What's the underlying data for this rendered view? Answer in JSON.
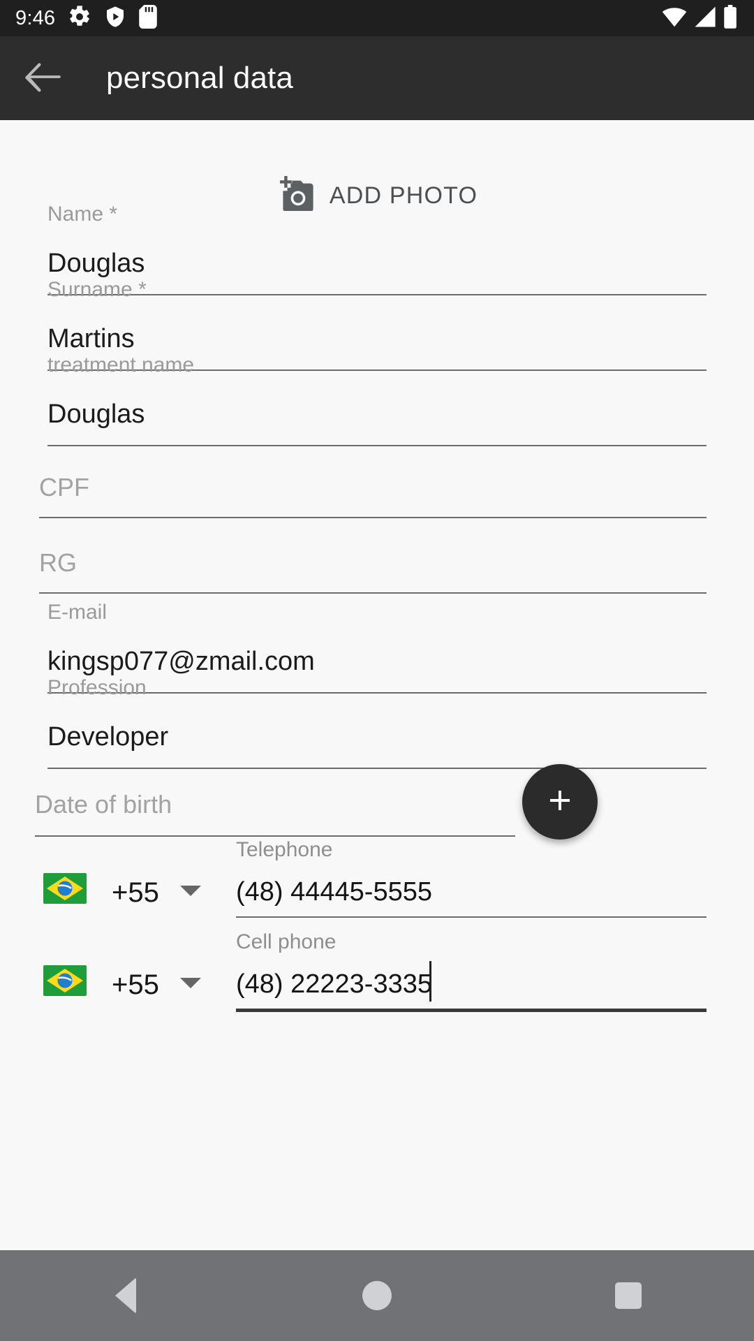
{
  "status_bar": {
    "time": "9:46",
    "left_icons": [
      "gear-icon",
      "play-protect-shield-icon",
      "sd-card-icon"
    ],
    "right_icons": [
      "wifi-icon",
      "cellular-signal-icon",
      "battery-icon"
    ],
    "background_color": "#1f1f1f"
  },
  "app_bar": {
    "back_icon": "back-arrow-icon",
    "title": "personal data",
    "background_color": "#2d2d2d"
  },
  "add_photo": {
    "icon": "add-a-photo-icon",
    "label": "ADD PHOTO"
  },
  "form": {
    "fields": [
      {
        "label": "Name *",
        "value": "Douglas",
        "placeholder": "",
        "filled": true
      },
      {
        "label": "Surname *",
        "value": "Martins",
        "placeholder": "",
        "filled": true
      },
      {
        "label": "treatment name",
        "value": "Douglas",
        "placeholder": "",
        "filled": true
      },
      {
        "label": "",
        "value": "",
        "placeholder": "CPF",
        "filled": false
      },
      {
        "label": "",
        "value": "",
        "placeholder": "RG",
        "filled": false
      },
      {
        "label": "E-mail",
        "value": "kingsp077@zmail.com",
        "placeholder": "",
        "filled": true
      },
      {
        "label": "Profession",
        "value": "Developer",
        "placeholder": "",
        "filled": true
      },
      {
        "label": "",
        "value": "",
        "placeholder": "Date of birth",
        "filled": false
      }
    ]
  },
  "fab": {
    "icon": "plus-icon",
    "color": "#2b2b2b"
  },
  "phones": [
    {
      "flag": "brazil-flag-icon",
      "country_code": "+55",
      "dropdown_icon": "chevron-down-icon",
      "label": "Telephone",
      "value": "(48) 44445-5555",
      "focused": false
    },
    {
      "flag": "brazil-flag-icon",
      "country_code": "+55",
      "dropdown_icon": "chevron-down-icon",
      "label": "Cell phone",
      "value": "(48) 22223-3335",
      "focused": true
    }
  ],
  "nav_bar": {
    "back": "back-triangle-icon",
    "home": "home-circle-icon",
    "recents": "recents-square-icon",
    "background_color": "#707276"
  }
}
